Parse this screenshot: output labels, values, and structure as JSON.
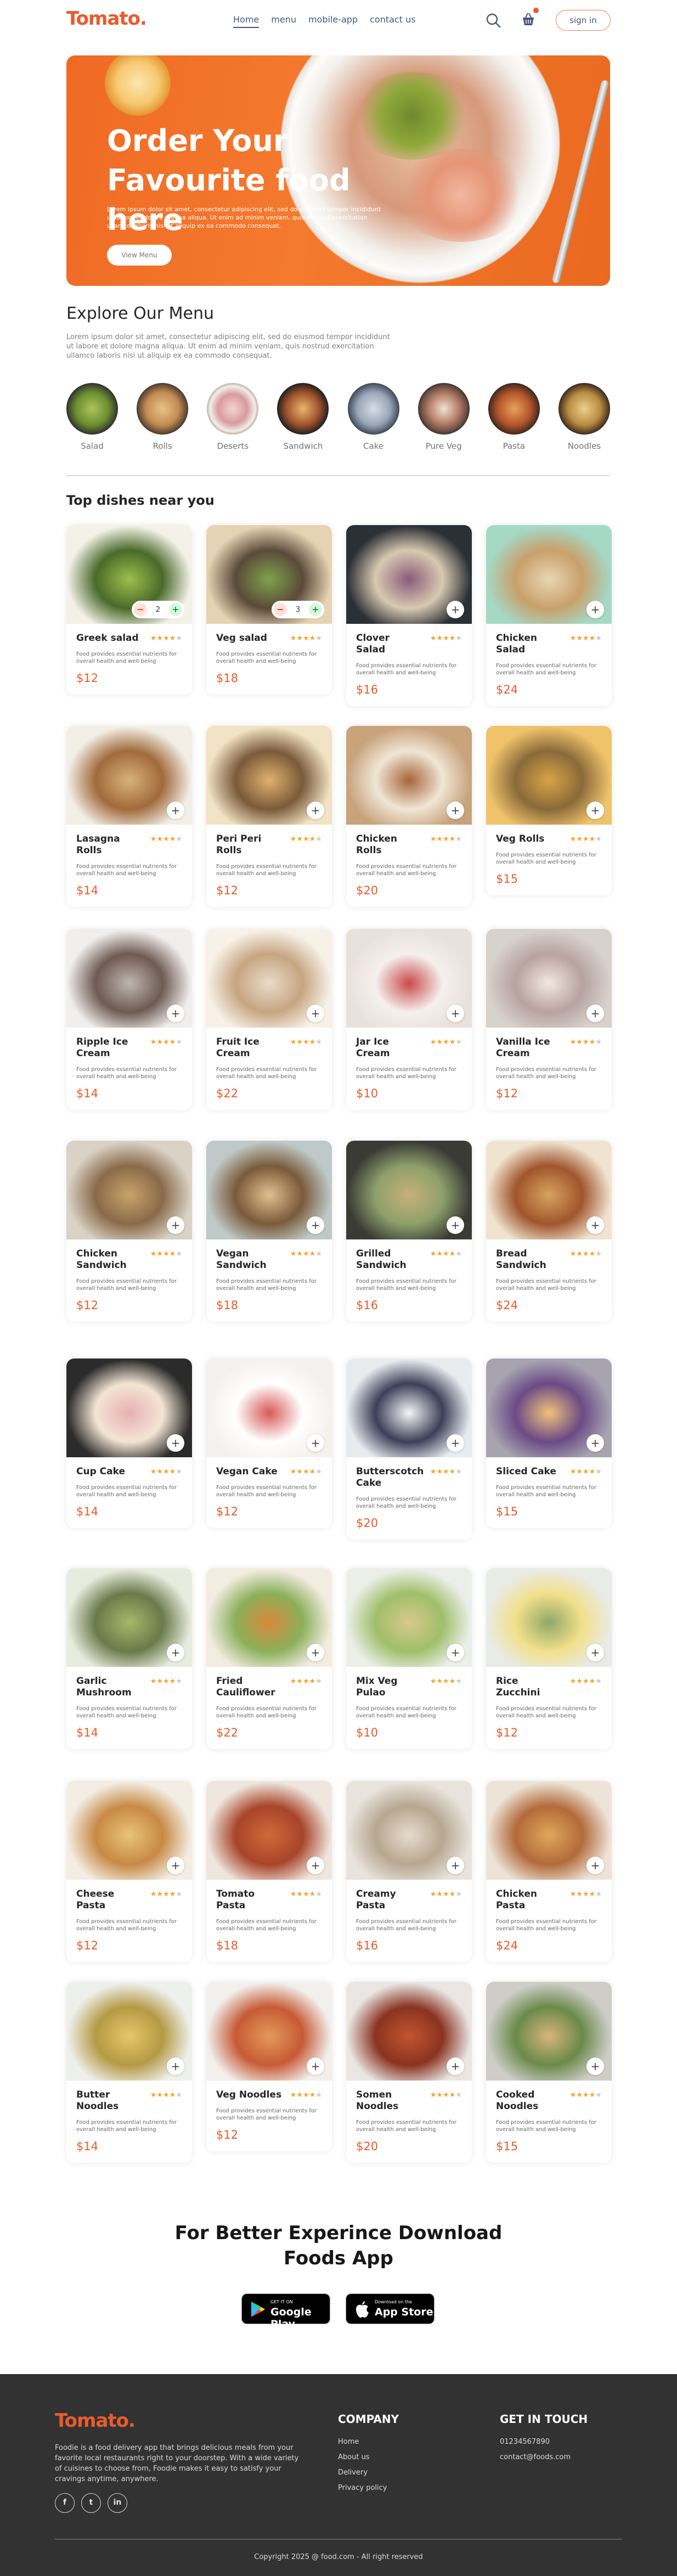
{
  "nav": {
    "logo": "Tomato.",
    "links": [
      {
        "label": "Home",
        "active": true
      },
      {
        "label": "menu",
        "active": false
      },
      {
        "label": "mobile-app",
        "active": false
      },
      {
        "label": "contact us",
        "active": false
      }
    ],
    "signin_label": "sign in",
    "icons": [
      "search-icon",
      "basket-icon"
    ]
  },
  "hero": {
    "title_line1": "Order Your",
    "title_line2": "Favourite food here",
    "text": "Lorem ipsum dolor sit amet, consectetur adipiscing elit, sed do eiusmod tempor incididunt ut labore et dolore magna aliqua. Ut enim ad minim veniam, quis nostrud exercitation ullamco laboris nisi ut aliquip ex ea commodo consequat.",
    "button_label": "View Menu"
  },
  "explore": {
    "title": "Explore Our Menu",
    "text": "Lorem ipsum dolor sit amet, consectetur adipiscing elit, sed do eiusmod tempor incididunt ut labore et dolore magna aliqua. Ut enim ad minim veniam, quis nostrud exercitation ullamco laboris nisi ut aliquip ex ea commodo consequat.",
    "categories": [
      "Salad",
      "Rolls",
      "Deserts",
      "Sandwich",
      "Cake",
      "Pure Veg",
      "Pasta",
      "Noodles"
    ]
  },
  "top_dishes": {
    "title": "Top dishes near you",
    "description": "Food provides essential nutrients for overall health and well-being",
    "rating": 4.5,
    "items": [
      {
        "name": "Greek salad",
        "price": "$12",
        "qty": "2"
      },
      {
        "name": "Veg salad",
        "price": "$18",
        "qty": "3"
      },
      {
        "name": "Clover Salad",
        "price": "$16"
      },
      {
        "name": "Chicken Salad",
        "price": "$24"
      },
      {
        "name": "Lasagna Rolls",
        "price": "$14"
      },
      {
        "name": "Peri Peri Rolls",
        "price": "$12"
      },
      {
        "name": "Chicken Rolls",
        "price": "$20"
      },
      {
        "name": "Veg Rolls",
        "price": "$15"
      },
      {
        "name": "Ripple Ice Cream",
        "price": "$14"
      },
      {
        "name": "Fruit Ice Cream",
        "price": "$22"
      },
      {
        "name": "Jar Ice Cream",
        "price": "$10"
      },
      {
        "name": "Vanilla Ice Cream",
        "price": "$12"
      },
      {
        "name": "Chicken Sandwich",
        "price": "$12"
      },
      {
        "name": "Vegan Sandwich",
        "price": "$18"
      },
      {
        "name": "Grilled Sandwich",
        "price": "$16"
      },
      {
        "name": "Bread Sandwich",
        "price": "$24"
      },
      {
        "name": "Cup Cake",
        "price": "$14"
      },
      {
        "name": "Vegan Cake",
        "price": "$12"
      },
      {
        "name": "Butterscotch Cake",
        "price": "$20"
      },
      {
        "name": "Sliced Cake",
        "price": "$15"
      },
      {
        "name": "Garlic Mushroom",
        "price": "$14"
      },
      {
        "name": "Fried Cauliflower",
        "price": "$22"
      },
      {
        "name": "Mix Veg Pulao",
        "price": "$10"
      },
      {
        "name": "Rice Zucchini",
        "price": "$12"
      },
      {
        "name": "Cheese Pasta",
        "price": "$12"
      },
      {
        "name": "Tomato Pasta",
        "price": "$18"
      },
      {
        "name": "Creamy Pasta",
        "price": "$16"
      },
      {
        "name": "Chicken Pasta",
        "price": "$24"
      },
      {
        "name": "Butter Noodles",
        "price": "$14"
      },
      {
        "name": "Veg Noodles",
        "price": "$12"
      },
      {
        "name": "Somen Noodles",
        "price": "$20"
      },
      {
        "name": "Cooked Noodles",
        "price": "$15"
      }
    ]
  },
  "app_download": {
    "title_line1": "For Better Experince Download",
    "title_line2": "Foods App",
    "google_small": "GET IT ON",
    "google_big": "Google Play",
    "apple_small": "Download on the",
    "apple_big": "App Store"
  },
  "footer": {
    "logo": "Tomato.",
    "text": "Foodie is a food delivery app that brings delicious meals from your favorite local restaurants right to your doorstep. With a wide variety of cuisines to choose from, Foodie makes it easy to satisfy your cravings anytime, anywhere.",
    "social": [
      "f",
      "t",
      "in"
    ],
    "company_title": "COMPANY",
    "company_links": [
      "Home",
      "About us",
      "Delivery",
      "Privacy policy"
    ],
    "contact_title": "GET IN TOUCH",
    "phone": "01234567890",
    "email": "contact@foods.com",
    "copyright": "Copyright 2025 @ food.com - All right reserved"
  },
  "colors": {
    "brand": "#ea5b2c",
    "hero_orange": "#f47a2e",
    "footer_bg": "#323232",
    "star": "#f2a530"
  }
}
